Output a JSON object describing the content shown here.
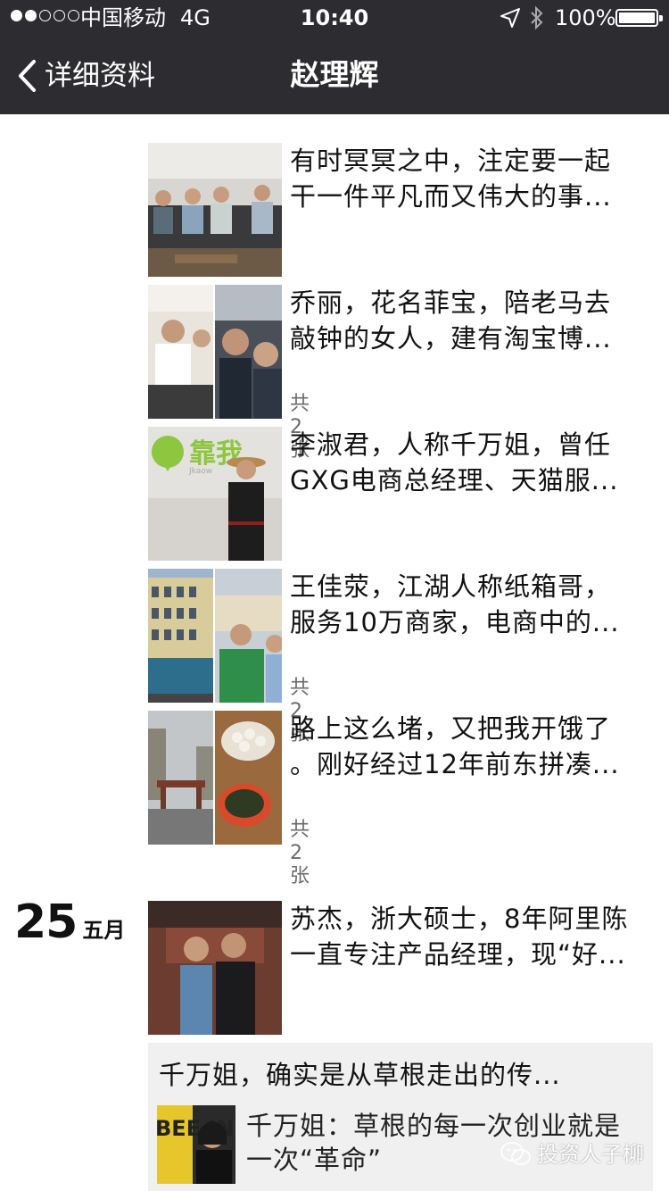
{
  "status_bar": {
    "carrier": "中国移动",
    "network": "4G",
    "time": "10:40",
    "battery": "100%",
    "signal_bars_filled": 2,
    "signal_bars_total": 5
  },
  "nav": {
    "back_label": "详细资料",
    "title": "赵理辉"
  },
  "posts": [
    {
      "line1": "有时冥冥之中，注定要一起",
      "line2": "干一件平凡而又伟大的事...",
      "count": ""
    },
    {
      "line1": "乔丽，花名菲宝，陪老马去",
      "line2": "敲钟的女人，建有淘宝博...",
      "count": "共2张"
    },
    {
      "line1": "李淑君，人称千万姐，曾任",
      "line2": "GXG电商总经理、天猫服...",
      "count": ""
    },
    {
      "line1": "王佳荥，江湖人称纸箱哥，",
      "line2": "服务10万商家，电商中的...",
      "count": "共2张"
    },
    {
      "line1": "路上这么堵，又把我开饿了",
      "line2": "。刚好经过12年前东拼凑...",
      "count": "共2张"
    },
    {
      "line1": "苏杰，浙大硕士，8年阿里陈",
      "line2": "一直专注产品经理，现“好...",
      "count": ""
    }
  ],
  "date_group": {
    "day": "25",
    "month": "五月"
  },
  "share": {
    "title": "千万姐，确实是从草根走出的传...",
    "line1": "千万姐：草根的每一次创业就是",
    "line2": "一次“革命”",
    "thumb_text": "BEE INS"
  },
  "watermark": "投资人子柳",
  "icons": {
    "back": "chevron-left-icon",
    "location": "location-arrow-icon",
    "bluetooth": "bluetooth-icon",
    "battery": "battery-icon",
    "wechat": "wechat-logo-icon"
  }
}
